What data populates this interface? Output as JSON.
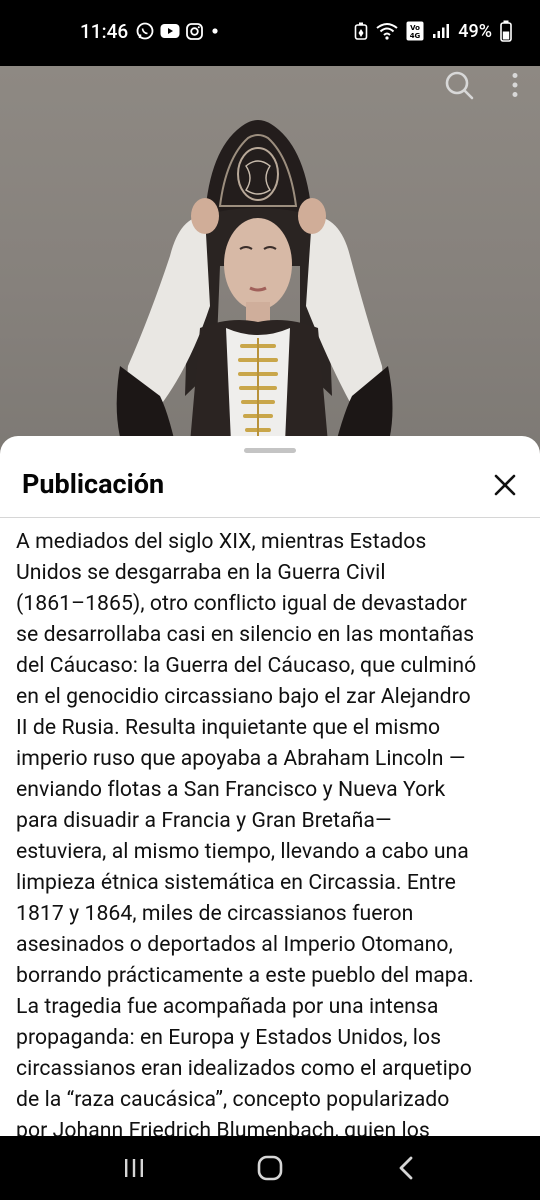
{
  "status_bar": {
    "time": "11:46",
    "battery": "49%",
    "app_icons": [
      "whatsapp-icon",
      "youtube-icon",
      "instagram-icon",
      "dot-icon"
    ],
    "system_icons": [
      "battery-saver-icon",
      "wifi-icon",
      "volte-icon",
      "signal-icon",
      "battery-icon"
    ]
  },
  "video": {
    "actions": [
      "search-icon",
      "more-vertical-icon"
    ]
  },
  "sheet": {
    "title": "Publicación",
    "text": "A mediados del siglo XIX, mientras Estados\nUnidos se desgarraba en la Guerra Civil\n(1861–1865), otro conflicto igual de devastador\nse desarrollaba casi en silencio en las montañas\ndel Cáucaso: la Guerra del Cáucaso, que culminó\nen el genocidio circassiano bajo el zar Alejandro\nII de Rusia. Resulta inquietante que el mismo\nimperio ruso que apoyaba a Abraham Lincoln —\nenviando flotas a San Francisco y Nueva York\npara disuadir a Francia y Gran Bretaña—\nestuviera, al mismo tiempo, llevando a cabo una\nlimpieza étnica sistemática en Circassia. Entre\n1817 y 1864, miles de circassianos fueron\nasesinados o deportados al Imperio Otomano,\nborrando prácticamente a este pueblo del mapa.\nLa tragedia fue acompañada por una intensa\npropaganda: en Europa y Estados Unidos, los\ncircassianos eran idealizados como el arquetipo\nde la “raza caucásica”, concepto popularizado\npor Johann Friedrich Blumenbach, quien los"
  },
  "nav_bar": {
    "buttons": [
      "recent-apps-icon",
      "home-icon",
      "back-icon"
    ]
  },
  "colors": {
    "sheet_bg": "#ffffff",
    "text": "#111111",
    "bars": "#000000"
  }
}
